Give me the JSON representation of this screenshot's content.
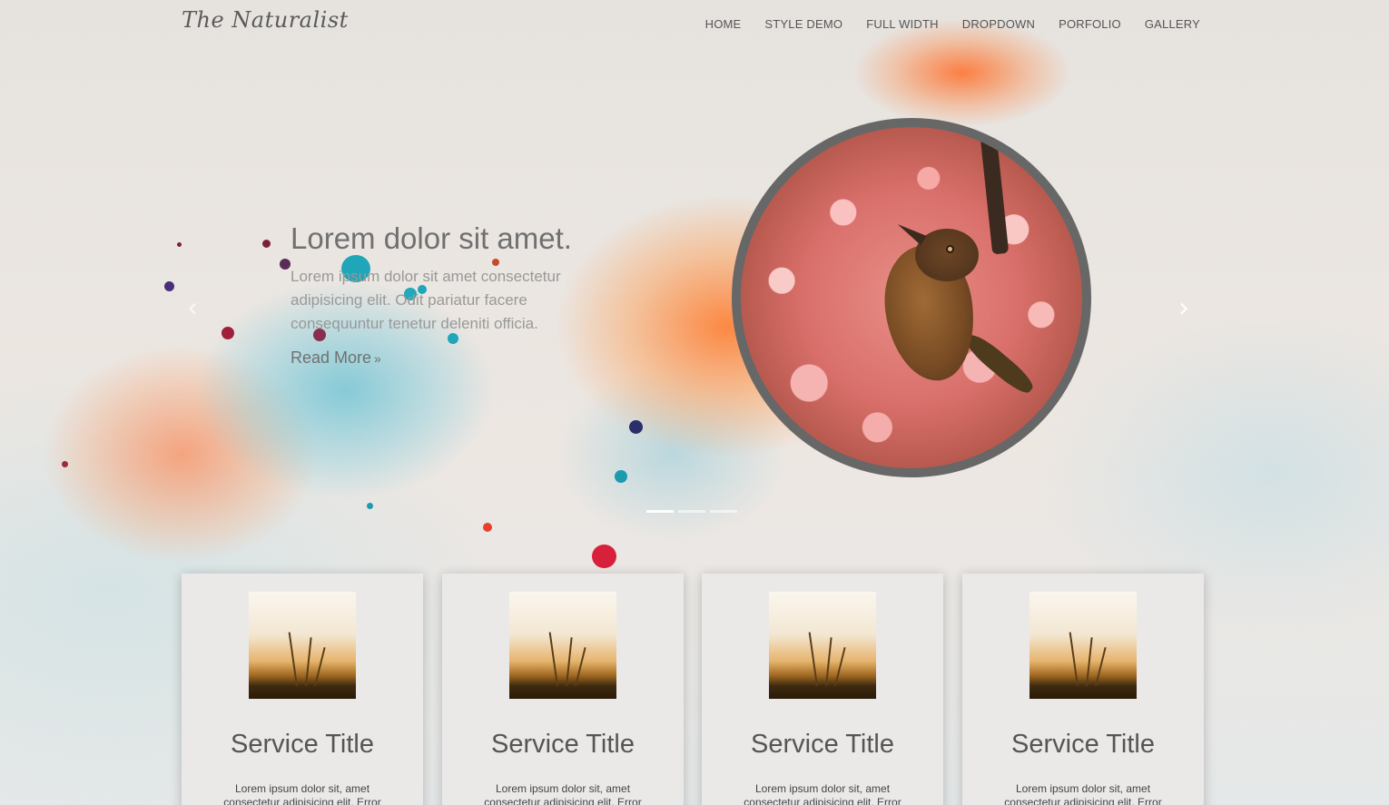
{
  "header": {
    "logo": "The Naturalist",
    "nav": [
      "HOME",
      "STYLE DEMO",
      "FULL WIDTH",
      "DROPDOWN",
      "PORFOLIO",
      "GALLERY"
    ]
  },
  "hero": {
    "title": "Lorem dolor sit amet.",
    "body": "Lorem ipsum dolor sit amet consectetur adipisicing elit. Odit pariatur facere consequuntur tenetur deleniti officia.",
    "read_more": "Read More",
    "read_more_suffix": "»",
    "prev_icon": "chevron-left-icon",
    "next_icon": "chevron-right-icon",
    "prev_glyph": "‹",
    "next_glyph": "›",
    "slide_count": 3,
    "active_slide": 1
  },
  "services": [
    {
      "title": "Service Title",
      "text": "Lorem ipsum dolor sit, amet consectetur adipisicing elit. Error"
    },
    {
      "title": "Service Title",
      "text": "Lorem ipsum dolor sit, amet consectetur adipisicing elit. Error"
    },
    {
      "title": "Service Title",
      "text": "Lorem ipsum dolor sit, amet consectetur adipisicing elit. Error"
    },
    {
      "title": "Service Title",
      "text": "Lorem ipsum dolor sit, amet consectetur adipisicing elit. Error"
    }
  ],
  "colors": {
    "accent_orange": "#ff7a33",
    "accent_teal": "#3bb3c6",
    "frame_gray": "#676767",
    "card_bg": "#ebe9e8"
  }
}
